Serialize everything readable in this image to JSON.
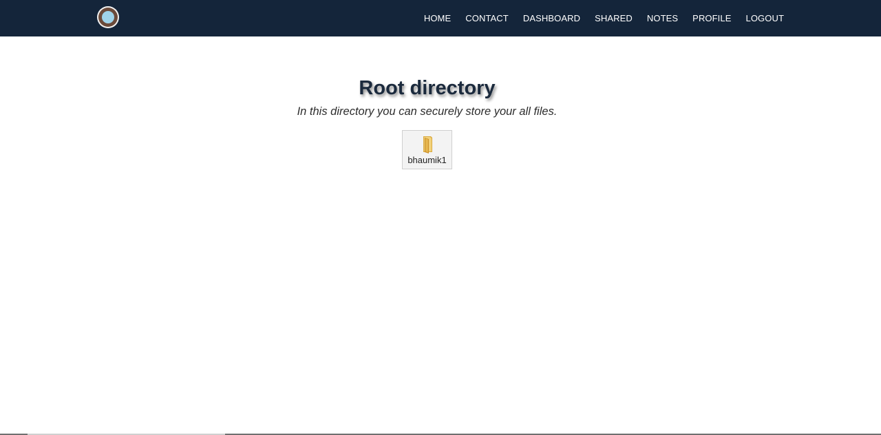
{
  "navbar": {
    "logo_alt": "logo",
    "links": [
      {
        "label": "HOME"
      },
      {
        "label": "CONTACT"
      },
      {
        "label": "DASHBOARD"
      },
      {
        "label": "SHARED"
      },
      {
        "label": "NOTES"
      },
      {
        "label": "PROFILE"
      },
      {
        "label": "LOGOUT"
      }
    ]
  },
  "main": {
    "title": "Root directory",
    "subtitle": "In this directory you can securely store your all files.",
    "folders": [
      {
        "name": "bhaumik1",
        "icon": "folder-icon"
      }
    ]
  },
  "colors": {
    "navbar_bg": "#14253a",
    "title": "#1b2a3d",
    "folder_yellow": "#e9c15a"
  }
}
